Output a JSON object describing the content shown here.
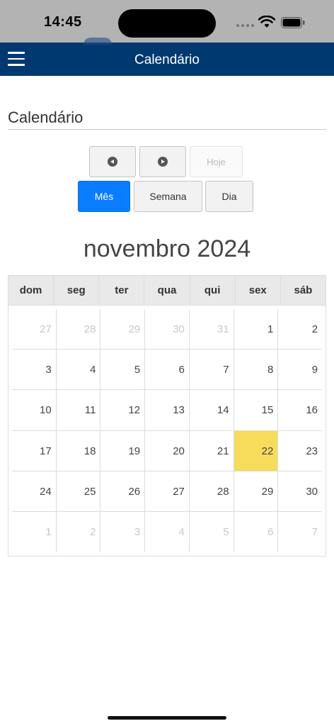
{
  "status_bar": {
    "time": "14:45"
  },
  "app_bar": {
    "title": "Calendário"
  },
  "page": {
    "heading": "Calendário"
  },
  "toolbar": {
    "prev_icon": "chevron-left-circle-icon",
    "next_icon": "chevron-right-circle-icon",
    "today_label": "Hoje",
    "month_label": "Mês",
    "week_label": "Semana",
    "day_label": "Dia"
  },
  "calendar": {
    "month_title": "novembro 2024",
    "weekdays": [
      "dom",
      "seg",
      "ter",
      "qua",
      "qui",
      "sex",
      "sáb"
    ],
    "today_color": "#f7dc5b",
    "weeks": [
      [
        {
          "d": "27",
          "other": true
        },
        {
          "d": "28",
          "other": true
        },
        {
          "d": "29",
          "other": true
        },
        {
          "d": "30",
          "other": true
        },
        {
          "d": "31",
          "other": true
        },
        {
          "d": "1"
        },
        {
          "d": "2"
        }
      ],
      [
        {
          "d": "3"
        },
        {
          "d": "4"
        },
        {
          "d": "5"
        },
        {
          "d": "6"
        },
        {
          "d": "7"
        },
        {
          "d": "8"
        },
        {
          "d": "9"
        }
      ],
      [
        {
          "d": "10"
        },
        {
          "d": "11"
        },
        {
          "d": "12"
        },
        {
          "d": "13"
        },
        {
          "d": "14"
        },
        {
          "d": "15"
        },
        {
          "d": "16"
        }
      ],
      [
        {
          "d": "17"
        },
        {
          "d": "18"
        },
        {
          "d": "19"
        },
        {
          "d": "20"
        },
        {
          "d": "21"
        },
        {
          "d": "22",
          "today": true
        },
        {
          "d": "23"
        }
      ],
      [
        {
          "d": "24"
        },
        {
          "d": "25"
        },
        {
          "d": "26"
        },
        {
          "d": "27"
        },
        {
          "d": "28"
        },
        {
          "d": "29"
        },
        {
          "d": "30"
        }
      ],
      [
        {
          "d": "1",
          "other": true
        },
        {
          "d": "2",
          "other": true
        },
        {
          "d": "3",
          "other": true
        },
        {
          "d": "4",
          "other": true
        },
        {
          "d": "5",
          "other": true
        },
        {
          "d": "6",
          "other": true
        },
        {
          "d": "7",
          "other": true
        }
      ]
    ]
  }
}
